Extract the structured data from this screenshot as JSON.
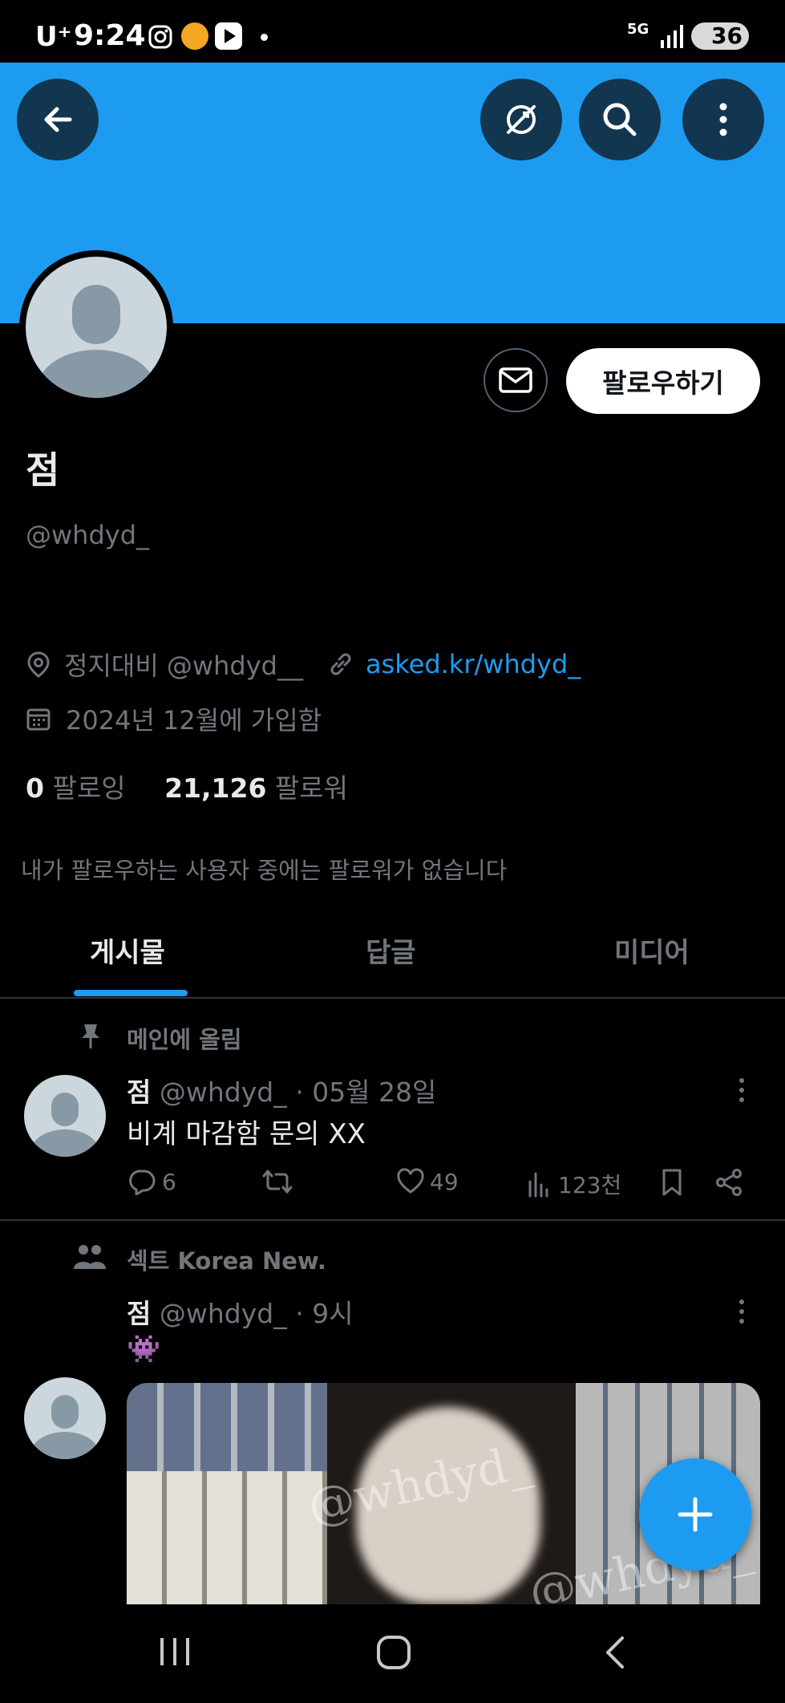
{
  "status_bar": {
    "carrier": "U⁺",
    "time": "9:24",
    "network": "5G",
    "battery": "36"
  },
  "profile": {
    "display_name": "점",
    "handle": "@whdyd_",
    "location": "정지대비 @whdyd__",
    "website": "asked.kr/whdyd_",
    "joined": "2024년 12월에 가입함",
    "following_count": "0",
    "following_label": "팔로잉",
    "followers_count": "21,126",
    "followers_label": "팔로워",
    "follower_notice": "내가 팔로우하는 사용자 중에는 팔로워가 없습니다",
    "follow_button": "팔로우하기"
  },
  "tabs": [
    {
      "label": "게시물",
      "active": true
    },
    {
      "label": "답글",
      "active": false
    },
    {
      "label": "미디어",
      "active": false
    }
  ],
  "posts": [
    {
      "context": "메인에 올림",
      "context_icon": "pin-icon",
      "author": "점",
      "handle": "@whdyd_",
      "time": "· 05월 28일",
      "text": "비계 마감함 문의 XX",
      "replies": "6",
      "reposts": "",
      "likes": "49",
      "views": "123천"
    },
    {
      "context": "섹트 Korea New.",
      "context_icon": "community-icon",
      "author": "점",
      "handle": "@whdyd_",
      "time": "· 9시",
      "text": "👾",
      "media_watermark": "@whdyd_"
    }
  ],
  "colors": {
    "accent": "#1d9bf0",
    "background": "#000000",
    "muted": "#71767b",
    "text": "#e7e9ea"
  }
}
